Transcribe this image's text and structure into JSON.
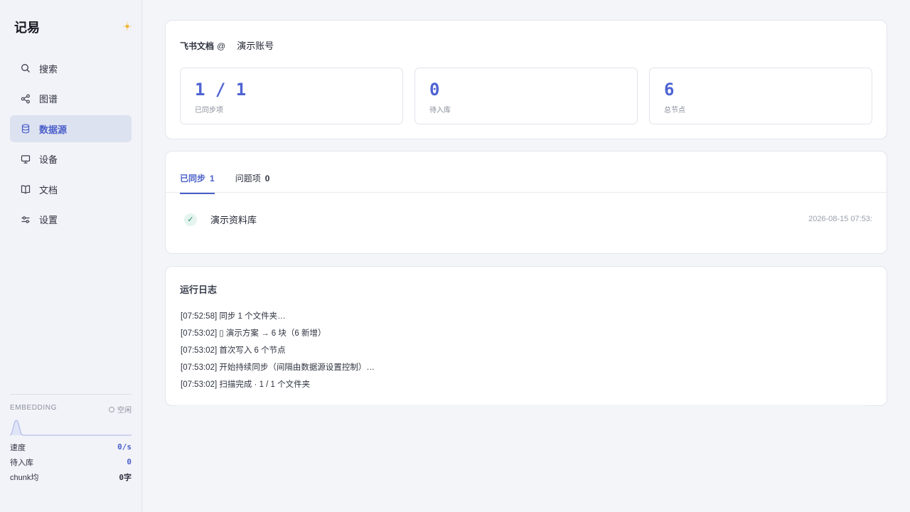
{
  "app": {
    "title": "记易"
  },
  "sidebar": {
    "items": [
      {
        "label": "搜索",
        "icon": "search-icon"
      },
      {
        "label": "图谱",
        "icon": "share-graph-icon"
      },
      {
        "label": "数据源",
        "icon": "database-icon",
        "active": true
      },
      {
        "label": "设备",
        "icon": "monitor-icon"
      },
      {
        "label": "文档",
        "icon": "book-icon"
      },
      {
        "label": "设置",
        "icon": "sliders-icon"
      }
    ]
  },
  "embedding": {
    "title": "EMBEDDING",
    "status": "空闲",
    "rows": [
      {
        "label": "速度",
        "value": "0/s"
      },
      {
        "label": "待入库",
        "value": "0"
      },
      {
        "label": "chunk均",
        "value": "0字"
      }
    ]
  },
  "source": {
    "label": "飞书文档",
    "at": "@",
    "account": "演示账号",
    "stats": [
      {
        "value": "1 / 1",
        "label": "已同步项"
      },
      {
        "value": "0",
        "label": "待入库"
      },
      {
        "value": "6",
        "label": "总节点"
      }
    ]
  },
  "tabs": [
    {
      "label": "已同步",
      "count": "1"
    },
    {
      "label": "问题项",
      "count": "0"
    }
  ],
  "synced": [
    {
      "name": "演示资料库",
      "time": "2026-08-15 07:53:"
    }
  ],
  "log": {
    "title": "运行日志",
    "lines": [
      "[07:52:58] 同步 1 个文件夹…",
      "[07:53:02] ▯ 演示方案 → 6 块（6 新增）",
      "[07:53:02] 首次写入 6 个节点",
      "[07:53:02] 开始持续同步（间隔由数据源设置控制）…",
      "[07:53:02] 扫描完成 · 1 / 1 个文件夹"
    ]
  },
  "colors": {
    "accent": "#4b5fc9",
    "active_bg": "#dde2f1",
    "success": "#1f8a66"
  }
}
